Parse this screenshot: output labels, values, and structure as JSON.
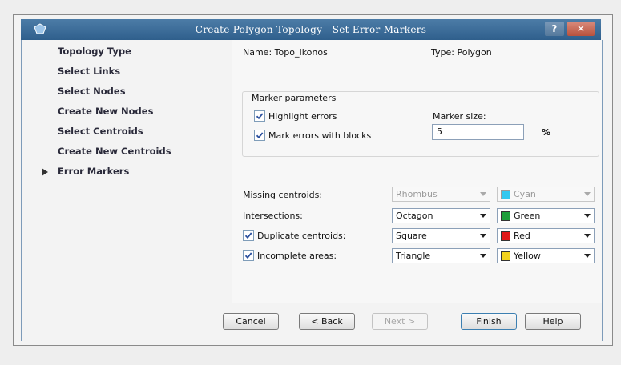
{
  "window": {
    "title": "Create Polygon Topology - Set Error Markers",
    "help_label": "?",
    "close_label": "✕"
  },
  "sidebar": {
    "items": [
      {
        "label": "Topology Type"
      },
      {
        "label": "Select Links"
      },
      {
        "label": "Select Nodes"
      },
      {
        "label": "Create New Nodes"
      },
      {
        "label": "Select Centroids"
      },
      {
        "label": "Create New Centroids"
      },
      {
        "label": "Error Markers",
        "current": true
      }
    ]
  },
  "header": {
    "name": "Name: Topo_Ikonos",
    "type": "Type: Polygon"
  },
  "marker_parameters": {
    "group_title": "Marker parameters",
    "highlight_errors": {
      "label": "Highlight errors",
      "checked": true
    },
    "mark_with_blocks": {
      "label": "Mark errors with blocks",
      "checked": true
    },
    "marker_size_label": "Marker size:",
    "marker_size_value": "5",
    "marker_size_unit": "%"
  },
  "error_rows": [
    {
      "label": "Missing centroids:",
      "has_checkbox": false,
      "enabled": false,
      "shape": "Rhombus",
      "color": "Cyan",
      "swatch": "#32c8f0"
    },
    {
      "label": "Intersections:",
      "has_checkbox": false,
      "enabled": true,
      "shape": "Octagon",
      "color": "Green",
      "swatch": "#1e9e3a"
    },
    {
      "label": "Duplicate centroids:",
      "has_checkbox": true,
      "checked": true,
      "enabled": true,
      "shape": "Square",
      "color": "Red",
      "swatch": "#e01818"
    },
    {
      "label": "Incomplete areas:",
      "has_checkbox": true,
      "checked": true,
      "enabled": true,
      "shape": "Triangle",
      "color": "Yellow",
      "swatch": "#f2d21c"
    }
  ],
  "buttons": {
    "cancel": "Cancel",
    "back": "< Back",
    "next": "Next >",
    "finish": "Finish",
    "help": "Help"
  },
  "colors": {
    "titlebar": "#3a6a96",
    "accent": "#3c7fb1"
  }
}
